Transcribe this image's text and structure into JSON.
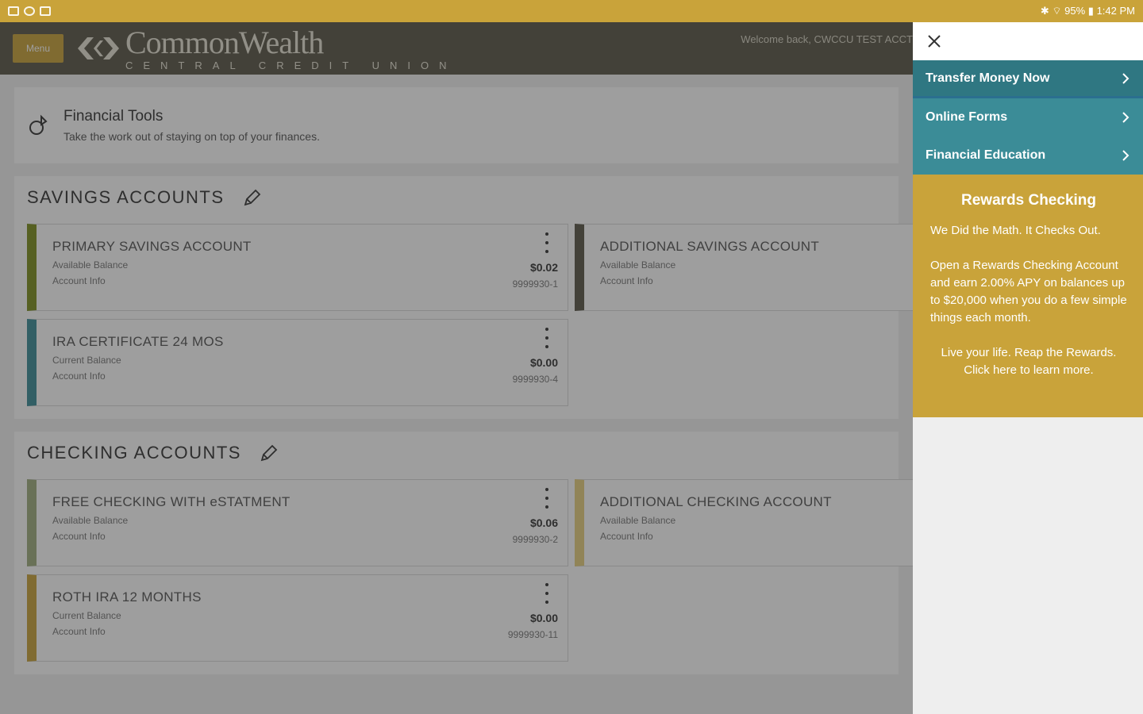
{
  "status_bar": {
    "right": "✱ ⌔ 95% ▮ 1:42 PM"
  },
  "header": {
    "menu_label": "Menu",
    "brand_title": "CommonWealth",
    "brand_subtitle": "CENTRAL CREDIT UNION",
    "welcome": "Welcome back, CWCCU TEST ACCT"
  },
  "tools": {
    "title": "Financial Tools",
    "desc": "Take the work out of staying on top of your finances."
  },
  "savings": {
    "title": "SAVINGS ACCOUNTS",
    "cards": [
      {
        "name": "PRIMARY SAVINGS ACCOUNT",
        "label": "Available Balance",
        "info": "Account Info",
        "amount": "$0.02",
        "num": "9999930-1",
        "color": "#7d8f1e"
      },
      {
        "name": "ADDITIONAL SAVINGS ACCOUNT",
        "label": "Available Balance",
        "info": "Account Info",
        "amount": "",
        "num": "",
        "color": "#5a5747"
      },
      {
        "name": "IRA CERTIFICATE 24 MOS",
        "label": "Current Balance",
        "info": "Account Info",
        "amount": "$0.00",
        "num": "9999930-4",
        "color": "#3b8c97"
      }
    ]
  },
  "checking": {
    "title": "CHECKING ACCOUNTS",
    "cards": [
      {
        "name": "FREE CHECKING WITH eSTATMENT",
        "label": "Available Balance",
        "info": "Account Info",
        "amount": "$0.06",
        "num": "9999930-2",
        "color": "#9fae7e"
      },
      {
        "name": "ADDITIONAL CHECKING ACCOUNT",
        "label": "Available Balance",
        "info": "Account Info",
        "amount": "",
        "num": "",
        "color": "#e8cf7e"
      },
      {
        "name": "ROTH IRA 12 MONTHS",
        "label": "Current Balance",
        "info": "Account Info",
        "amount": "$0.00",
        "num": "9999930-11",
        "color": "#c9a33a"
      }
    ]
  },
  "drawer": {
    "nav": [
      {
        "label": "Transfer Money Now"
      },
      {
        "label": "Online Forms"
      },
      {
        "label": "Financial Education"
      }
    ],
    "promo": {
      "title": "Rewards Checking",
      "p1": "We Did the Math. It Checks Out.",
      "p2": "Open a Rewards Checking Account and earn 2.00% APY on balances up to $20,000 when you do a few simple things each month.",
      "cta": "Live your life. Reap the Rewards. Click here to learn more."
    }
  }
}
